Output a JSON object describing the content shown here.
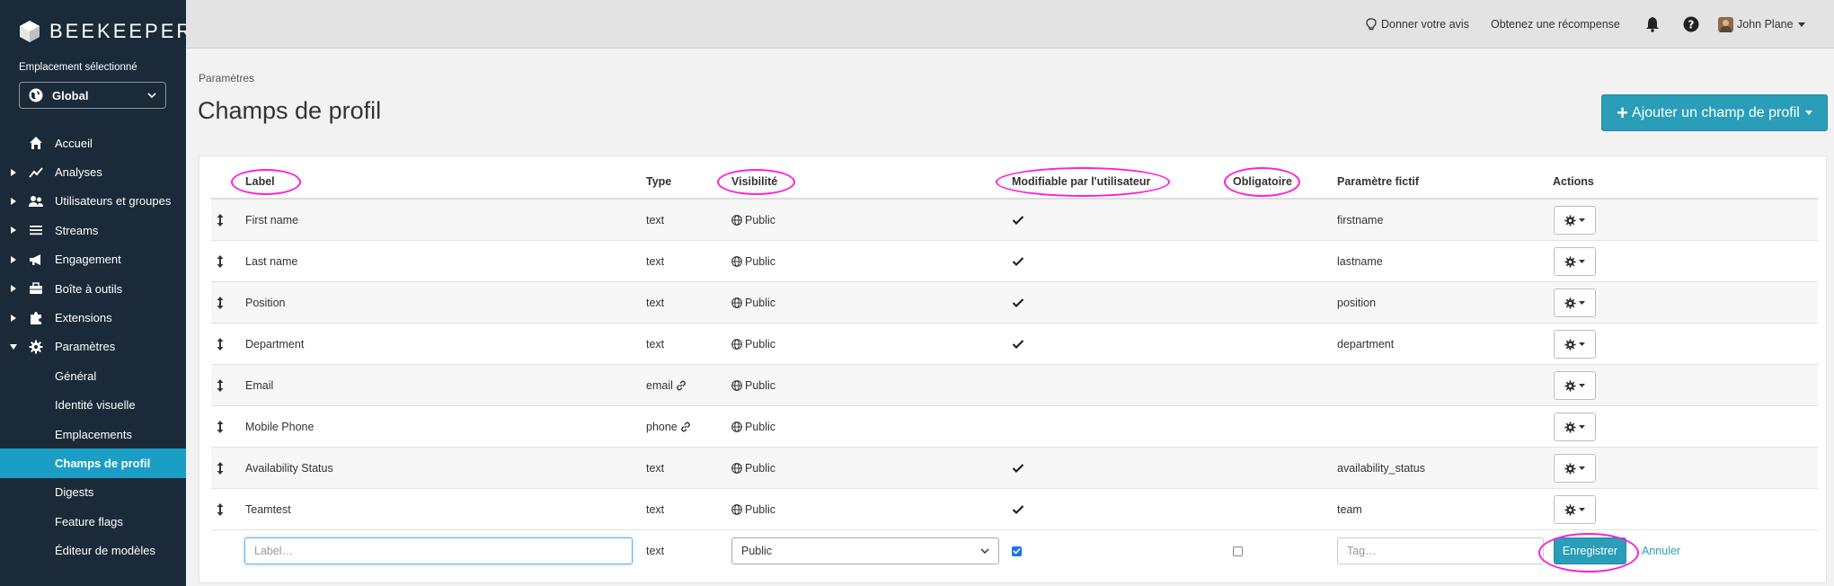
{
  "sidebar": {
    "brand": "BEEKEEPER",
    "location_label": "Emplacement sélectionné",
    "location_value": "Global",
    "items": [
      {
        "label": "Accueil",
        "icon": "home-icon",
        "expandable": false
      },
      {
        "label": "Analyses",
        "icon": "chart-icon",
        "expandable": true
      },
      {
        "label": "Utilisateurs et groupes",
        "icon": "users-icon",
        "expandable": true
      },
      {
        "label": "Streams",
        "icon": "list-icon",
        "expandable": true
      },
      {
        "label": "Engagement",
        "icon": "megaphone-icon",
        "expandable": true
      },
      {
        "label": "Boîte à outils",
        "icon": "toolbox-icon",
        "expandable": true
      },
      {
        "label": "Extensions",
        "icon": "puzzle-icon",
        "expandable": true
      },
      {
        "label": "Paramètres",
        "icon": "gear-icon",
        "expandable": true,
        "expanded": true
      }
    ],
    "sub_items": [
      {
        "label": "Général",
        "active": false
      },
      {
        "label": "Identité visuelle",
        "active": false
      },
      {
        "label": "Emplacements",
        "active": false
      },
      {
        "label": "Champs de profil",
        "active": true
      },
      {
        "label": "Digests",
        "active": false
      },
      {
        "label": "Feature flags",
        "active": false
      },
      {
        "label": "Éditeur de modèles",
        "active": false
      }
    ]
  },
  "topbar": {
    "feedback": "Donner votre avis",
    "reward": "Obtenez une récompense",
    "user": "John Plane"
  },
  "page": {
    "breadcrumb": "Paramètres",
    "title": "Champs de profil",
    "add_button": "Ajouter un champ de profil"
  },
  "table": {
    "headers": {
      "label": "Label",
      "type": "Type",
      "visibility": "Visibilité",
      "editable": "Modifiable par l'utilisateur",
      "required": "Obligatoire",
      "placeholder": "Paramètre fictif",
      "actions": "Actions"
    },
    "rows": [
      {
        "label": "First name",
        "type": "text",
        "type_link": false,
        "visibility": "Public",
        "editable": true,
        "required": false,
        "placeholder": "firstname"
      },
      {
        "label": "Last name",
        "type": "text",
        "type_link": false,
        "visibility": "Public",
        "editable": true,
        "required": false,
        "placeholder": "lastname"
      },
      {
        "label": "Position",
        "type": "text",
        "type_link": false,
        "visibility": "Public",
        "editable": true,
        "required": false,
        "placeholder": "position"
      },
      {
        "label": "Department",
        "type": "text",
        "type_link": false,
        "visibility": "Public",
        "editable": true,
        "required": false,
        "placeholder": "department"
      },
      {
        "label": "Email",
        "type": "email",
        "type_link": true,
        "visibility": "Public",
        "editable": false,
        "required": false,
        "placeholder": ""
      },
      {
        "label": "Mobile Phone",
        "type": "phone",
        "type_link": true,
        "visibility": "Public",
        "editable": false,
        "required": false,
        "placeholder": ""
      },
      {
        "label": "Availability Status",
        "type": "text",
        "type_link": false,
        "visibility": "Public",
        "editable": true,
        "required": false,
        "placeholder": "availability_status"
      },
      {
        "label": "Teamtest",
        "type": "text",
        "type_link": false,
        "visibility": "Public",
        "editable": true,
        "required": false,
        "placeholder": "team"
      }
    ],
    "new_row": {
      "label_placeholder": "Label…",
      "label_value": "",
      "type": "text",
      "visibility": "Public",
      "editable_checked": true,
      "required_checked": false,
      "tag_placeholder": "Tag…",
      "save_label": "Enregistrer",
      "cancel_label": "Annuler"
    }
  },
  "colors": {
    "sidebar_bg": "#1b2a38",
    "accent": "#2a9db9",
    "active_nav": "#1a9ec6",
    "annotation": "#ff1fd6"
  }
}
